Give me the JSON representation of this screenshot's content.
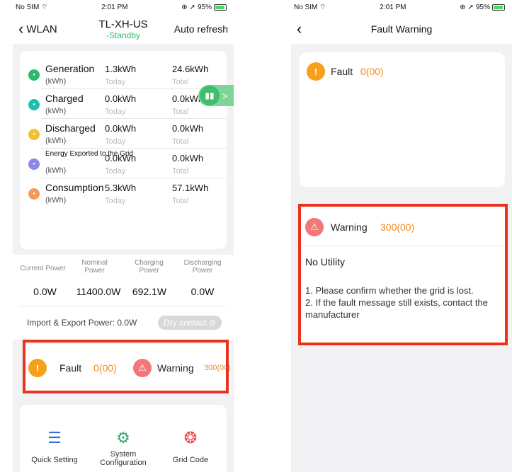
{
  "status": {
    "carrier": "No SIM",
    "time": "2:01 PM",
    "battery": "95%"
  },
  "left": {
    "nav": {
      "back": "WLAN",
      "title": "TL-XH-US",
      "subtitle": "-Standby",
      "right": "Auto refresh"
    },
    "energy_rows": [
      {
        "name": "Generation",
        "unit": "(kWh)",
        "today_value": "1.3kWh",
        "today_label": "Today",
        "total_value": "24.6kWh",
        "total_label": "Total",
        "icon": "generation-icon",
        "color": "#2fb96a"
      },
      {
        "name": "Charged",
        "unit": "(kWh)",
        "today_value": "0.0kWh",
        "today_label": "Today",
        "total_value": "0.0kWh",
        "total_label": "Total",
        "icon": "charged-icon",
        "color": "#1fbfb0"
      },
      {
        "name": "Discharged",
        "unit": "(kWh)",
        "today_value": "0.0kWh",
        "today_label": "Today",
        "total_value": "0.0kWh",
        "total_label": "Total",
        "icon": "discharged-icon",
        "color": "#f2c230"
      },
      {
        "name": "Energy Exported to the Grid",
        "unit": "(kWh)",
        "today_value": "0.0kWh",
        "today_label": "Today",
        "total_value": "0.0kWh",
        "total_label": "Total",
        "icon": "grid-export-icon",
        "color": "#8d86e6"
      },
      {
        "name": "Consumption",
        "unit": "(kWh)",
        "today_value": "5.3kWh",
        "today_label": "Today",
        "total_value": "57.1kWh",
        "total_label": "Total",
        "icon": "consumption-icon",
        "color": "#f59a5a"
      }
    ],
    "power": {
      "labels": [
        "Current Power",
        "Nominal Power",
        "Charging Power",
        "Discharging Power"
      ],
      "values": [
        "0.0W",
        "11400.0W",
        "692.1W",
        "0.0W"
      ],
      "import_export": "Import & Export Power: 0.0W",
      "dry_contact": "Dry contact"
    },
    "alerts": {
      "fault_label": "Fault",
      "fault_value": "0(00)",
      "warning_label": "Warning",
      "warning_value": "300(00)"
    },
    "tools": [
      "Quick Setting",
      "System Configuration",
      "Grid Code"
    ]
  },
  "right": {
    "nav": {
      "title": "Fault Warning"
    },
    "fault": {
      "label": "Fault",
      "value": "0(00)"
    },
    "warning": {
      "label": "Warning",
      "value": "300(00)",
      "title": "No Utility",
      "lines": [
        "1. Please confirm whether the grid is lost.",
        "2. If the fault message still exists, contact the manufacturer"
      ]
    }
  },
  "colors": {
    "accent_green": "#32b56e",
    "warning_orange": "#f08a1c",
    "highlight_red": "#e8341c"
  }
}
